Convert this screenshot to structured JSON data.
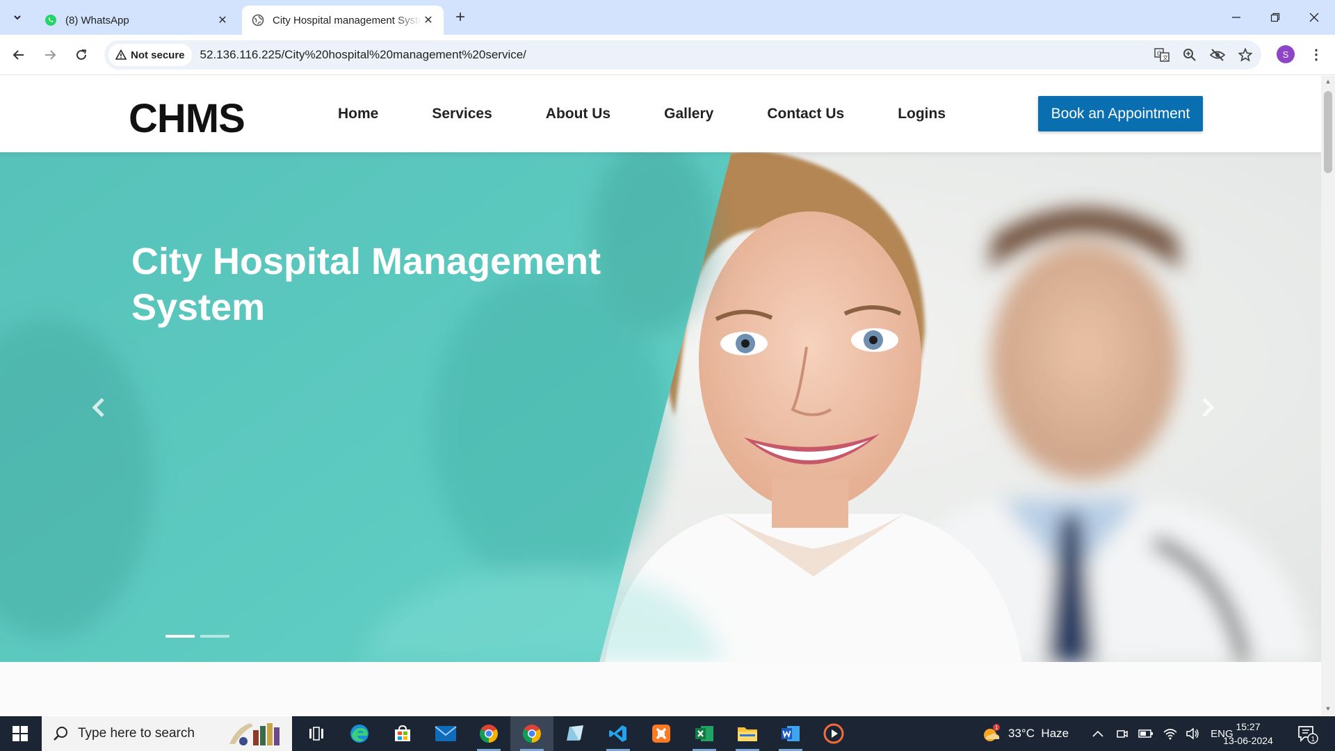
{
  "browser": {
    "tabs": [
      {
        "title": "(8) WhatsApp",
        "active": false
      },
      {
        "title": "City Hospital management System",
        "active": true
      }
    ],
    "security_label": "Not secure",
    "url": "52.136.116.225/City%20hospital%20management%20service/",
    "profile_initial": "S"
  },
  "site": {
    "logo": "CHMS",
    "nav": [
      "Home",
      "Services",
      "About Us",
      "Gallery",
      "Contact Us",
      "Logins"
    ],
    "cta": "Book an Appointment",
    "hero": {
      "title_line1": "City Hospital Management",
      "title_line2": "System",
      "slides_total": 2,
      "active_slide": 1
    }
  },
  "taskbar": {
    "search_placeholder": "Type here to search",
    "weather": "33°C  Haze",
    "language": "ENG",
    "time": "15:27",
    "date": "13-06-2024",
    "notification_count": "1",
    "weather_badge": "1"
  },
  "colors": {
    "accent": "#0a6fb1",
    "teal": "#5ecdc4",
    "tabstrip": "#d3e3fd",
    "taskbar": "#1c2533"
  }
}
